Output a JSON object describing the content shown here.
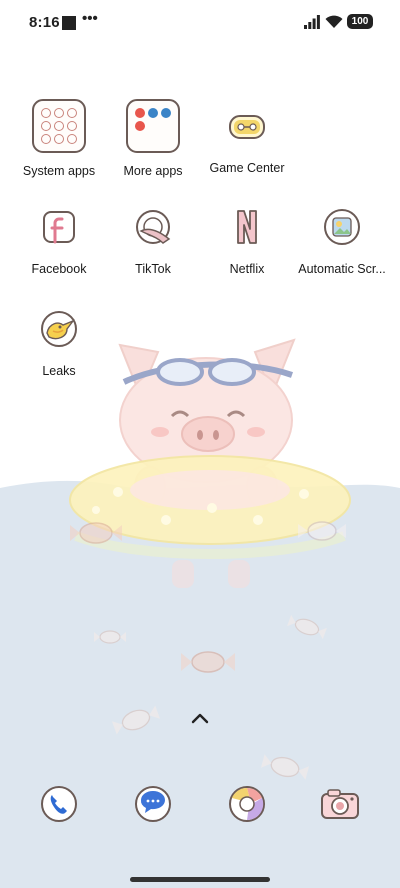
{
  "status_bar": {
    "time": "8:16",
    "dots": "•••",
    "battery": "100"
  },
  "apps": {
    "system_apps": "System apps",
    "more_apps": "More apps",
    "game_center": "Game Center",
    "facebook": "Facebook",
    "tiktok": "TikTok",
    "netflix": "Netflix",
    "automatic": "Automatic Scr...",
    "leaks": "Leaks"
  },
  "dock": {
    "items": [
      "phone-icon",
      "messages-icon",
      "browser-icon",
      "camera-icon"
    ]
  },
  "colors": {
    "water": "#dce6ef",
    "outline": "#6b5b56",
    "pig_pink": "#fbe3e0",
    "float_yellow": "#fdf3b6"
  }
}
